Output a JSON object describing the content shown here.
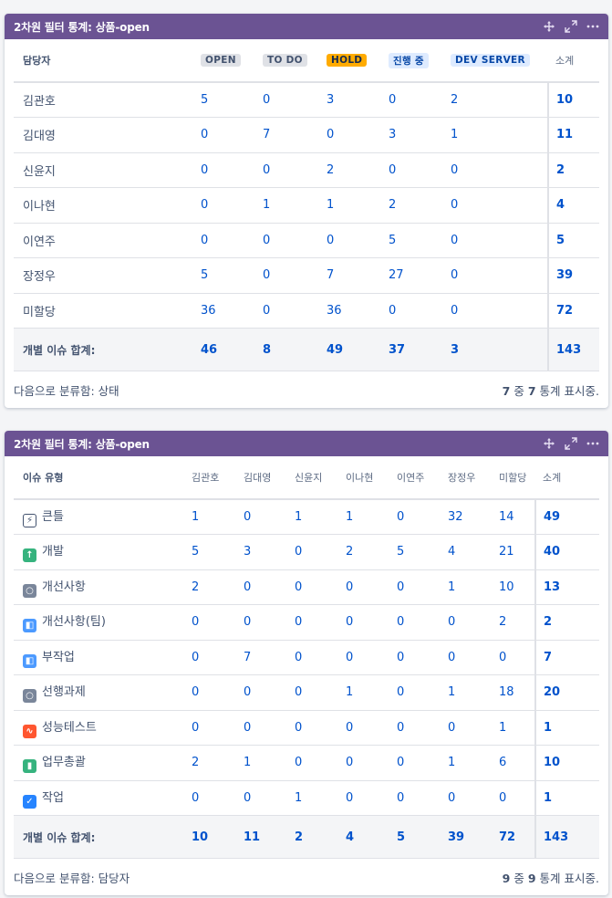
{
  "gadget1": {
    "title": "2차원 필터 통계: 상품-open",
    "row_header": "담당자",
    "columns": [
      {
        "label": "OPEN",
        "bg": "#dfe1e6",
        "fg": "#42526e"
      },
      {
        "label": "TO DO",
        "bg": "#dfe1e6",
        "fg": "#42526e"
      },
      {
        "label": "HOLD",
        "bg": "#ffab00",
        "fg": "#172b4d"
      },
      {
        "label": "진행 중",
        "bg": "#deebff",
        "fg": "#0747a6"
      },
      {
        "label": "DEV SERVER",
        "bg": "#deebff",
        "fg": "#0747a6"
      }
    ],
    "total_header": "소계",
    "rows": [
      {
        "name": "김관호",
        "values": [
          "5",
          "0",
          "3",
          "0",
          "2"
        ],
        "total": "10"
      },
      {
        "name": "김대영",
        "values": [
          "0",
          "7",
          "0",
          "3",
          "1"
        ],
        "total": "11"
      },
      {
        "name": "신윤지",
        "values": [
          "0",
          "0",
          "2",
          "0",
          "0"
        ],
        "total": "2"
      },
      {
        "name": "이나현",
        "values": [
          "0",
          "1",
          "1",
          "2",
          "0"
        ],
        "total": "4"
      },
      {
        "name": "이연주",
        "values": [
          "0",
          "0",
          "0",
          "5",
          "0"
        ],
        "total": "5"
      },
      {
        "name": "장정우",
        "values": [
          "5",
          "0",
          "7",
          "27",
          "0"
        ],
        "total": "39"
      },
      {
        "name": "미할당",
        "values": [
          "36",
          "0",
          "36",
          "0",
          "0"
        ],
        "total": "72"
      }
    ],
    "sum_label": "개별 이슈 합계:",
    "sums": [
      "46",
      "8",
      "49",
      "37",
      "3"
    ],
    "sum_total": "143",
    "footer_left": "다음으로 분류함: 상태",
    "footer_shown": "7",
    "footer_of": "중",
    "footer_total": "7",
    "footer_suffix": "통계 표시중."
  },
  "gadget2": {
    "title": "2차원 필터 통계: 상품-open",
    "row_header": "이슈 유형",
    "columns": [
      "김관호",
      "김대영",
      "신윤지",
      "이나현",
      "이연주",
      "장정우",
      "미할당"
    ],
    "total_header": "소계",
    "rows": [
      {
        "name": "큰틀",
        "icon": "epic-lightning-icon",
        "color": "#ffffff",
        "border": "#42526e",
        "glyph": "⚡",
        "values": [
          "1",
          "0",
          "1",
          "1",
          "0",
          "32",
          "14"
        ],
        "total": "49"
      },
      {
        "name": "개발",
        "icon": "arrow-up-icon",
        "color": "#36b37e",
        "glyph": "↑",
        "values": [
          "5",
          "3",
          "0",
          "2",
          "5",
          "4",
          "21"
        ],
        "total": "40"
      },
      {
        "name": "개선사항",
        "icon": "circle-icon",
        "color": "#7a869a",
        "glyph": "○",
        "values": [
          "2",
          "0",
          "0",
          "0",
          "0",
          "1",
          "10"
        ],
        "total": "13"
      },
      {
        "name": "개선사항(팀)",
        "icon": "subtask-icon",
        "color": "#4c9aff",
        "glyph": "◧",
        "values": [
          "0",
          "0",
          "0",
          "0",
          "0",
          "0",
          "2"
        ],
        "total": "2"
      },
      {
        "name": "부작업",
        "icon": "subtask-icon",
        "color": "#4c9aff",
        "glyph": "◧",
        "values": [
          "0",
          "7",
          "0",
          "0",
          "0",
          "0",
          "0"
        ],
        "total": "7"
      },
      {
        "name": "선행과제",
        "icon": "circle-icon",
        "color": "#7a869a",
        "glyph": "○",
        "values": [
          "0",
          "0",
          "0",
          "1",
          "0",
          "1",
          "18"
        ],
        "total": "20"
      },
      {
        "name": "성능테스트",
        "icon": "pulse-icon",
        "color": "#ff5630",
        "glyph": "∿",
        "values": [
          "0",
          "0",
          "0",
          "0",
          "0",
          "0",
          "1"
        ],
        "total": "1"
      },
      {
        "name": "업무총괄",
        "icon": "bookmark-icon",
        "color": "#36b37e",
        "glyph": "▮",
        "values": [
          "2",
          "1",
          "0",
          "0",
          "0",
          "1",
          "6"
        ],
        "total": "10"
      },
      {
        "name": "작업",
        "icon": "checkbox-icon",
        "color": "#2684ff",
        "glyph": "✓",
        "values": [
          "0",
          "0",
          "1",
          "0",
          "0",
          "0",
          "0"
        ],
        "total": "1"
      }
    ],
    "sum_label": "개별 이슈 합계:",
    "sums": [
      "10",
      "11",
      "2",
      "4",
      "5",
      "39",
      "72"
    ],
    "sum_total": "143",
    "footer_left": "다음으로 분류함: 담당자",
    "footer_shown": "9",
    "footer_of": "중",
    "footer_total": "9",
    "footer_suffix": "통계 표시중."
  }
}
